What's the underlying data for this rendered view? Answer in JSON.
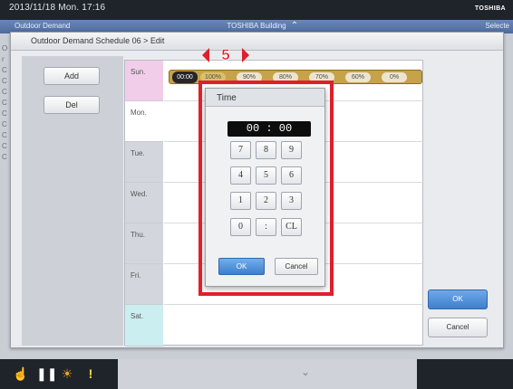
{
  "topbar": {
    "datetime": "2013/11/18  Mon.  17:16",
    "brand": "TOSHIBA"
  },
  "subbar": {
    "title": "Outdoor Demand",
    "building": "TOSHIBA Building",
    "selected": "Selecte"
  },
  "dialog": {
    "title": "Outdoor Demand Schedule 06 > Edit"
  },
  "left_buttons": {
    "add": "Add",
    "del": "Del"
  },
  "days": [
    "Sun.",
    "Mon.",
    "Tue.",
    "Wed.",
    "Thu.",
    "Fri.",
    "Sat."
  ],
  "schedule_chip": {
    "time": "00:00",
    "percents": [
      "100%",
      "90%",
      "80%",
      "70%",
      "60%",
      "0%"
    ]
  },
  "right_buttons": {
    "ok": "OK",
    "cancel": "Cancel"
  },
  "time_popup": {
    "title": "Time",
    "display": "00 : 00",
    "keys": [
      "7",
      "8",
      "9",
      "4",
      "5",
      "6",
      "1",
      "2",
      "3",
      "0",
      ":",
      "CL"
    ],
    "ok": "OK",
    "cancel": "Cancel"
  },
  "callout": {
    "label": "5",
    "color": "#e01f2b"
  },
  "left_strip_chars": [
    "O",
    "r",
    "C",
    "C",
    "C",
    "C",
    "C",
    "C",
    "C",
    "C",
    "C"
  ],
  "bottom_icons": [
    "hand-icon",
    "pause-icon",
    "sun-icon",
    "alert-icon"
  ],
  "colors": {
    "accent": "#3f7fcb",
    "highlight": "#e01f2b",
    "topbar": "#1f242b"
  }
}
